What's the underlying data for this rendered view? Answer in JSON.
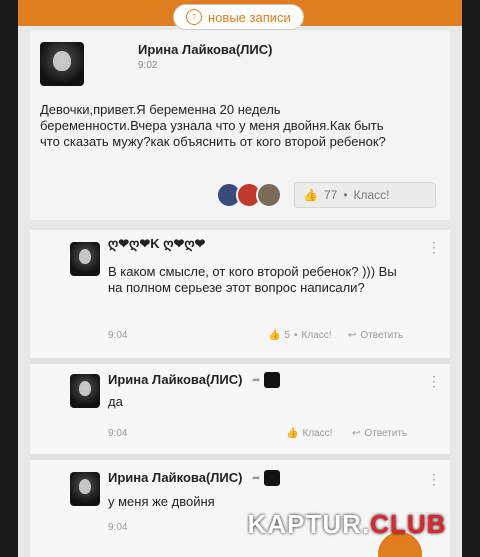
{
  "topbar": {
    "new_posts_label": "новые записи",
    "up_icon": "↑"
  },
  "post": {
    "author": "Ирина Лайкова(ЛИС)",
    "time": "9:02",
    "text": "Девочки,привет.Я беременна 20 недель беременности.Вчера узнала что у меня двойня.Как быть что сказать мужу?как объяснить от кого второй ребенок?",
    "likes": "77",
    "like_label": "Класс!"
  },
  "comments": [
    {
      "author": "ღ❤ღ❤K ღ❤ღ❤",
      "text": "В каком смысле,  от кого второй ребенок? ))) Вы на полном серьезе этот вопрос написали?",
      "time": "9:04",
      "likes": "5",
      "like_label": "Класс!",
      "reply_label": "Ответить"
    },
    {
      "author": "Ирина Лайкова(ЛИС)",
      "text": "да",
      "time": "9:04",
      "like_label": "Класс!",
      "reply_label": "Ответить"
    },
    {
      "author": "Ирина Лайкова(ЛИС)",
      "text": "у меня же двойня",
      "time": "9:04"
    }
  ],
  "watermark": {
    "main": "KAPTUR.",
    "accent": "CLUB"
  },
  "colors": {
    "accent": "#e07d1e",
    "watermark_red": "#e3222a"
  }
}
